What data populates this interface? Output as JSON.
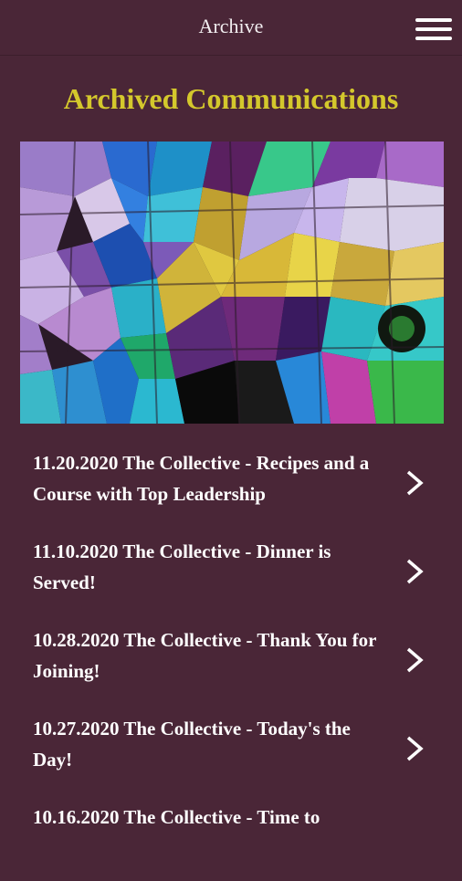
{
  "header": {
    "title": "Archive",
    "menu_icon": "hamburger-menu-icon"
  },
  "page": {
    "heading": "Archived Communications",
    "hero_image": "stained-glass-mosaic-image"
  },
  "colors": {
    "background": "#4a2637",
    "heading": "#d4c82c",
    "text": "#ffffff"
  },
  "archive": {
    "items": [
      {
        "label": "11.20.2020 The Collective - Recipes and a Course with Top Leadership",
        "icon": "chevron-right-icon"
      },
      {
        "label": "11.10.2020 The Collective - Dinner is Served!",
        "icon": "chevron-right-icon"
      },
      {
        "label": "10.28.2020 The Collective - Thank You for Joining!",
        "icon": "chevron-right-icon"
      },
      {
        "label": "10.27.2020 The Collective - Today's the Day!",
        "icon": "chevron-right-icon"
      },
      {
        "label": "10.16.2020 The Collective - Time to",
        "icon": "chevron-right-icon"
      }
    ]
  }
}
